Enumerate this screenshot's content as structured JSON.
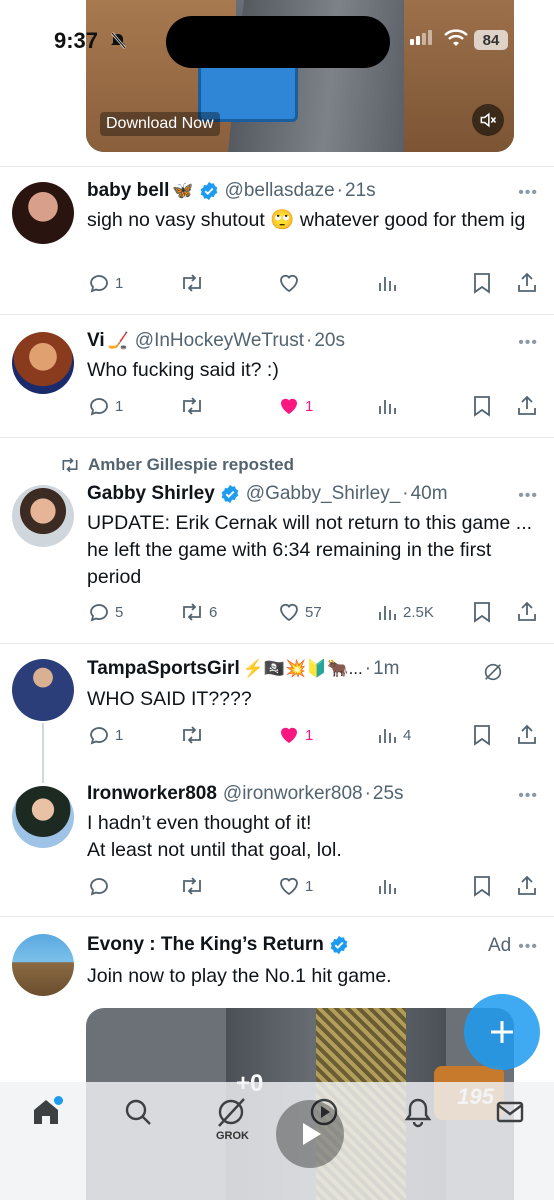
{
  "status_bar": {
    "time": "9:37",
    "battery": "84"
  },
  "top_ad": {
    "download_label": "Download Now"
  },
  "tweets": [
    {
      "name": "baby bell",
      "name_emoji": "🦋",
      "handle": "@bellasdaze",
      "time": "21s",
      "text": "sigh no vasy shutout 🙄 whatever good for them ig",
      "replies": "1",
      "reposts": "",
      "likes": "",
      "views": ""
    },
    {
      "name": "Vi",
      "name_emoji": "🏒",
      "handle": "@InHockeyWeTrust",
      "time": "20s",
      "text": "Who fucking said it? :)",
      "replies": "1",
      "reposts": "",
      "likes": "1",
      "views": ""
    },
    {
      "repost_by": "Amber Gillespie reposted",
      "name": "Gabby Shirley",
      "handle": "@Gabby_Shirley_",
      "time": "40m",
      "text": "UPDATE: Erik Cernak will not return to this game ... he left the game with 6:34 remaining in the first period",
      "replies": "5",
      "reposts": "6",
      "likes": "57",
      "views": "2.5K"
    },
    {
      "name": "TampaSportsGirl",
      "name_emoji": "⚡🏴‍☠️💥🔰🐂...",
      "handle": "",
      "time": "1m",
      "text": "WHO SAID IT????",
      "replies": "1",
      "reposts": "",
      "likes": "1",
      "views": "4"
    },
    {
      "name": "Ironworker808",
      "handle": "@ironworker808",
      "time": "25s",
      "text_lines": [
        "I hadn’t even thought of it!",
        "At least not until that goal, lol."
      ],
      "replies": "",
      "reposts": "",
      "likes": "1",
      "views": ""
    },
    {
      "name": "Evony : The King’s Return",
      "ad_label": "Ad",
      "text": "Join now to play the No.1 hit game."
    }
  ],
  "bottom_ad": {
    "plus_label": "+0",
    "count_label": "195"
  },
  "nav": {
    "grok_label": "GROK"
  },
  "colors": {
    "accent": "#1d9bf0",
    "like": "#f91880",
    "muted": "#536471"
  }
}
